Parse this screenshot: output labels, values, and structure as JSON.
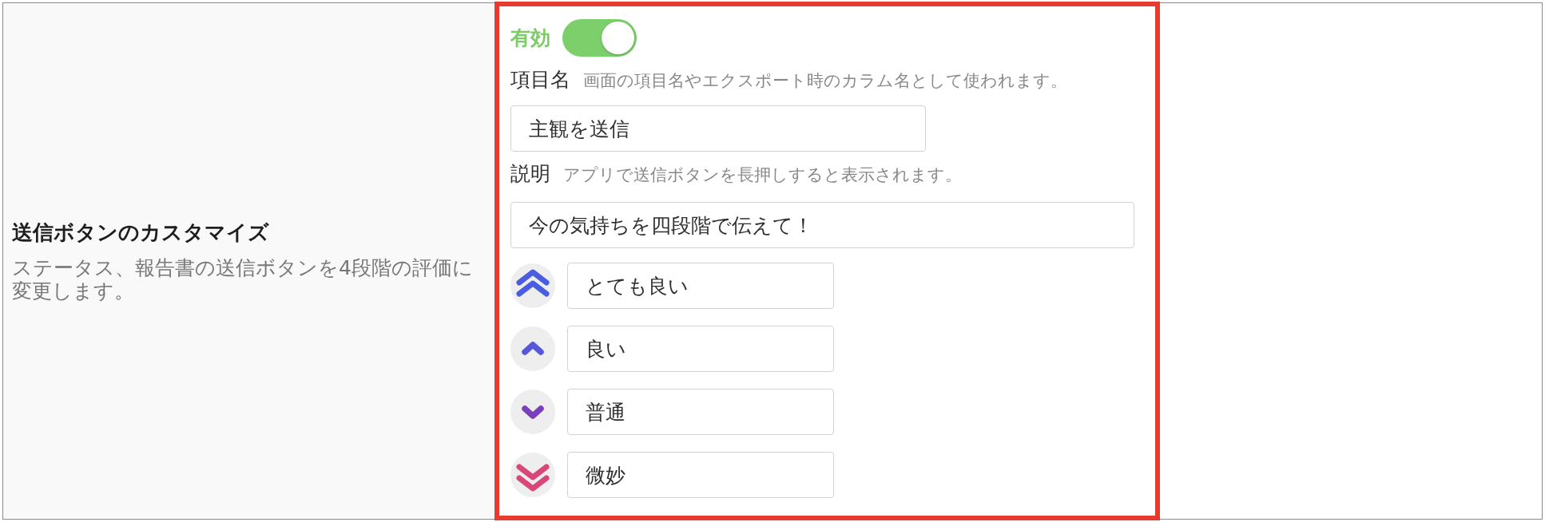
{
  "setting": {
    "title": "送信ボタンのカスタマイズ",
    "description": "ステータス、報告書の送信ボタンを4段階の評価に変更します。"
  },
  "enabled_toggle": {
    "label": "有効",
    "on": true
  },
  "fields": [
    {
      "kind": "name",
      "label": "項目名",
      "hint": "画面の項目名やエクスポート時のカラム名として使われます。",
      "value": "主観を送信"
    },
    {
      "kind": "description",
      "label": "説明",
      "hint": "アプリで送信ボタンを長押しすると表示されます。",
      "value": "今の気持ちを四段階で伝えて！"
    }
  ],
  "ratings": [
    {
      "kind": "double-up",
      "color": "#4a5de0",
      "value": "とても良い"
    },
    {
      "kind": "up",
      "color": "#5757da",
      "value": "良い"
    },
    {
      "kind": "down",
      "color": "#7a3fba",
      "value": "普通"
    },
    {
      "kind": "double-down",
      "color": "#d9477a",
      "value": "微妙"
    }
  ]
}
